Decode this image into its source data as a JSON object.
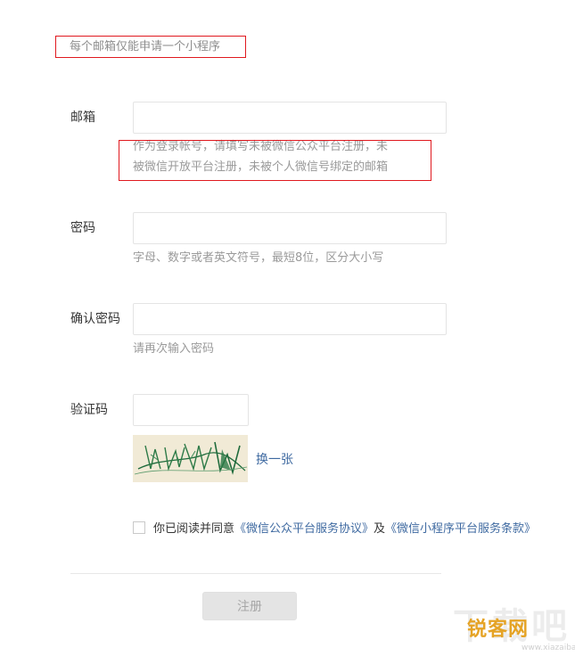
{
  "notice": "每个邮箱仅能申请一个小程序",
  "fields": {
    "email": {
      "label": "邮箱",
      "value": "",
      "tip_line1": "作为登录帐号，请填写未被微信公众平台注册，未",
      "tip_line2": "被微信开放平台注册，未被个人微信号绑定的邮箱"
    },
    "password": {
      "label": "密码",
      "value": "",
      "tip": "字母、数字或者英文符号，最短8位，区分大小写"
    },
    "confirm": {
      "label": "确认密码",
      "value": "",
      "tip": "请再次输入密码"
    },
    "captcha": {
      "label": "验证码",
      "value": "",
      "change_link": "换一张"
    }
  },
  "agreement": {
    "prefix": "你已阅读并同意",
    "link1": "《微信公众平台服务协议》",
    "middle": "及",
    "link2": "《微信小程序平台服务条款》",
    "checked": false
  },
  "submit_label": "注册",
  "watermark": {
    "brand": "锐客网",
    "bg": "下载吧",
    "url": "www.xiazaiba.com"
  },
  "colors": {
    "accent_red": "#e0191f",
    "link": "#3f6aa1",
    "button_bg": "#e4e4e4"
  }
}
